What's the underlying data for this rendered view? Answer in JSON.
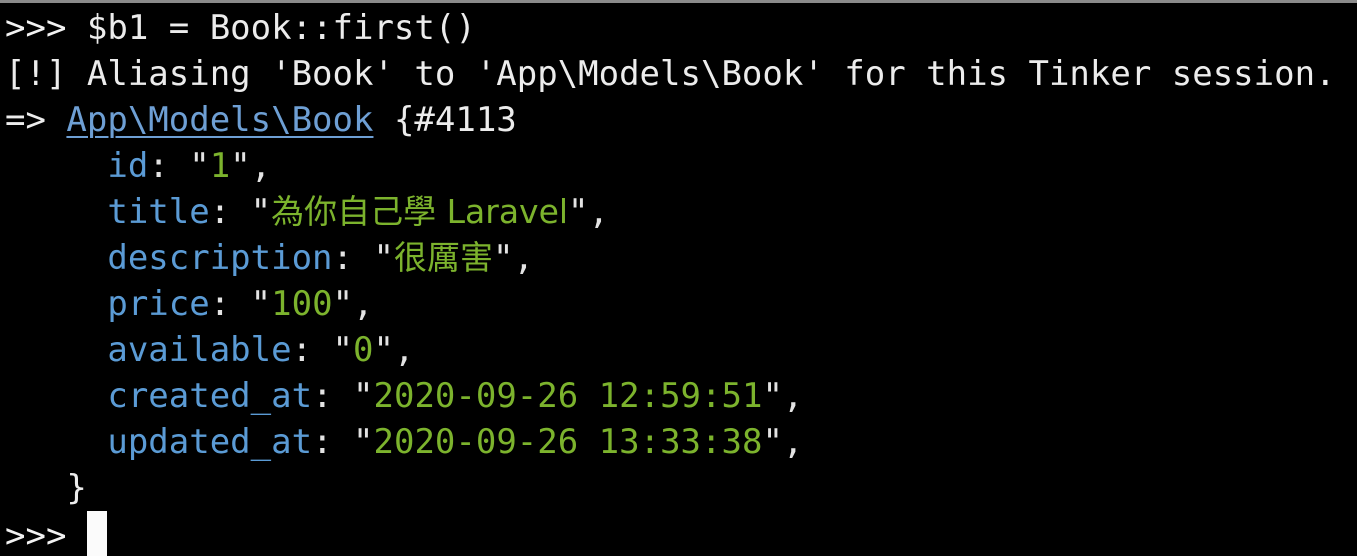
{
  "terminal": {
    "title": "PHP Artisan Tinker REPL",
    "background_color": "#000000",
    "foreground_color": "#ececec",
    "colors": {
      "plain": "#ececec",
      "key_blue": "#5b9bd5",
      "class_blue": "#6e9fd4",
      "value_green": "#7cb32d",
      "cursor_white": "#fbfbfb",
      "top_border_gray": "#8a8a8a"
    },
    "prompt_symbol": ">>>",
    "lines": [
      {
        "id": "input-command",
        "prompt": ">>> ",
        "command": "$b1 = Book::first()"
      },
      {
        "id": "alias-notice",
        "text": "[!] Aliasing 'Book' to 'App\\Models\\Book' for this Tinker session."
      },
      {
        "id": "result-header",
        "arrow": "=> ",
        "class_name": "App\\Models\\Book",
        "object_id": " {#4113"
      }
    ],
    "properties": [
      {
        "indent": "     ",
        "key": "id",
        "colon": ": ",
        "open_quote": "\"",
        "value": "1",
        "close_quote": "\",",
        "cjk": false
      },
      {
        "indent": "     ",
        "key": "title",
        "colon": ": ",
        "open_quote": "\"",
        "value": "為你自己學 Laravel",
        "close_quote": "\",",
        "cjk": true
      },
      {
        "indent": "     ",
        "key": "description",
        "colon": ": ",
        "open_quote": "\"",
        "value": "很厲害",
        "close_quote": "\",",
        "cjk": true
      },
      {
        "indent": "     ",
        "key": "price",
        "colon": ": ",
        "open_quote": "\"",
        "value": "100",
        "close_quote": "\",",
        "cjk": false
      },
      {
        "indent": "     ",
        "key": "available",
        "colon": ": ",
        "open_quote": "\"",
        "value": "0",
        "close_quote": "\",",
        "cjk": false
      },
      {
        "indent": "     ",
        "key": "created_at",
        "colon": ": ",
        "open_quote": "\"",
        "value": "2020-09-26 12:59:51",
        "close_quote": "\",",
        "cjk": false
      },
      {
        "indent": "     ",
        "key": "updated_at",
        "colon": ": ",
        "open_quote": "\"",
        "value": "2020-09-26 13:33:38",
        "close_quote": "\",",
        "cjk": false
      }
    ],
    "closing_brace": {
      "indent": "   ",
      "text": "}"
    },
    "final_prompt": {
      "prompt": ">>> ",
      "cursor": "block"
    }
  }
}
